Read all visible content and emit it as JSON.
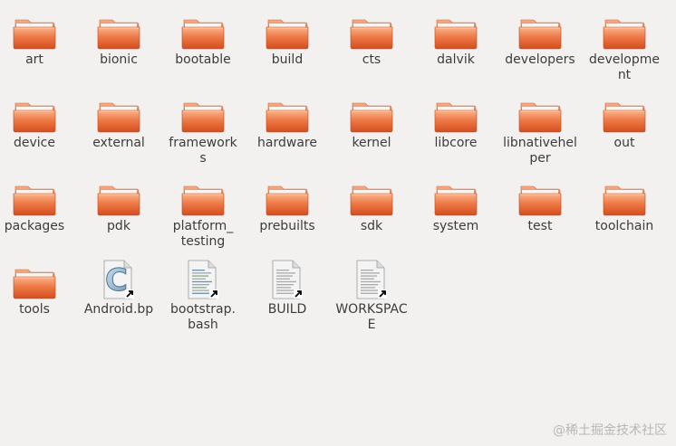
{
  "items": [
    {
      "label": "art",
      "type": "folder"
    },
    {
      "label": "bionic",
      "type": "folder"
    },
    {
      "label": "bootable",
      "type": "folder"
    },
    {
      "label": "build",
      "type": "folder"
    },
    {
      "label": "cts",
      "type": "folder"
    },
    {
      "label": "dalvik",
      "type": "folder"
    },
    {
      "label": "developers",
      "type": "folder"
    },
    {
      "label": "developme\nnt",
      "type": "folder"
    },
    {
      "label": "device",
      "type": "folder"
    },
    {
      "label": "external",
      "type": "folder"
    },
    {
      "label": "framework\ns",
      "type": "folder"
    },
    {
      "label": "hardware",
      "type": "folder"
    },
    {
      "label": "kernel",
      "type": "folder"
    },
    {
      "label": "libcore",
      "type": "folder"
    },
    {
      "label": "libnativehel\nper",
      "type": "folder"
    },
    {
      "label": "out",
      "type": "folder"
    },
    {
      "label": "packages",
      "type": "folder"
    },
    {
      "label": "pdk",
      "type": "folder"
    },
    {
      "label": "platform_\ntesting",
      "type": "folder"
    },
    {
      "label": "prebuilts",
      "type": "folder"
    },
    {
      "label": "sdk",
      "type": "folder"
    },
    {
      "label": "system",
      "type": "folder"
    },
    {
      "label": "test",
      "type": "folder"
    },
    {
      "label": "toolchain",
      "type": "folder"
    },
    {
      "label": "tools",
      "type": "folder"
    },
    {
      "label": "Android.bp",
      "type": "c-source-link"
    },
    {
      "label": "bootstrap.\nbash",
      "type": "script-link"
    },
    {
      "label": "BUILD",
      "type": "text-link"
    },
    {
      "label": "WORKSPAC\nE",
      "type": "text-link"
    }
  ],
  "watermark": "@稀土掘金技术社区",
  "colors": {
    "folder_top": "#f7a878",
    "folder_bottom": "#d9501f",
    "background": "#f2f1f0"
  }
}
